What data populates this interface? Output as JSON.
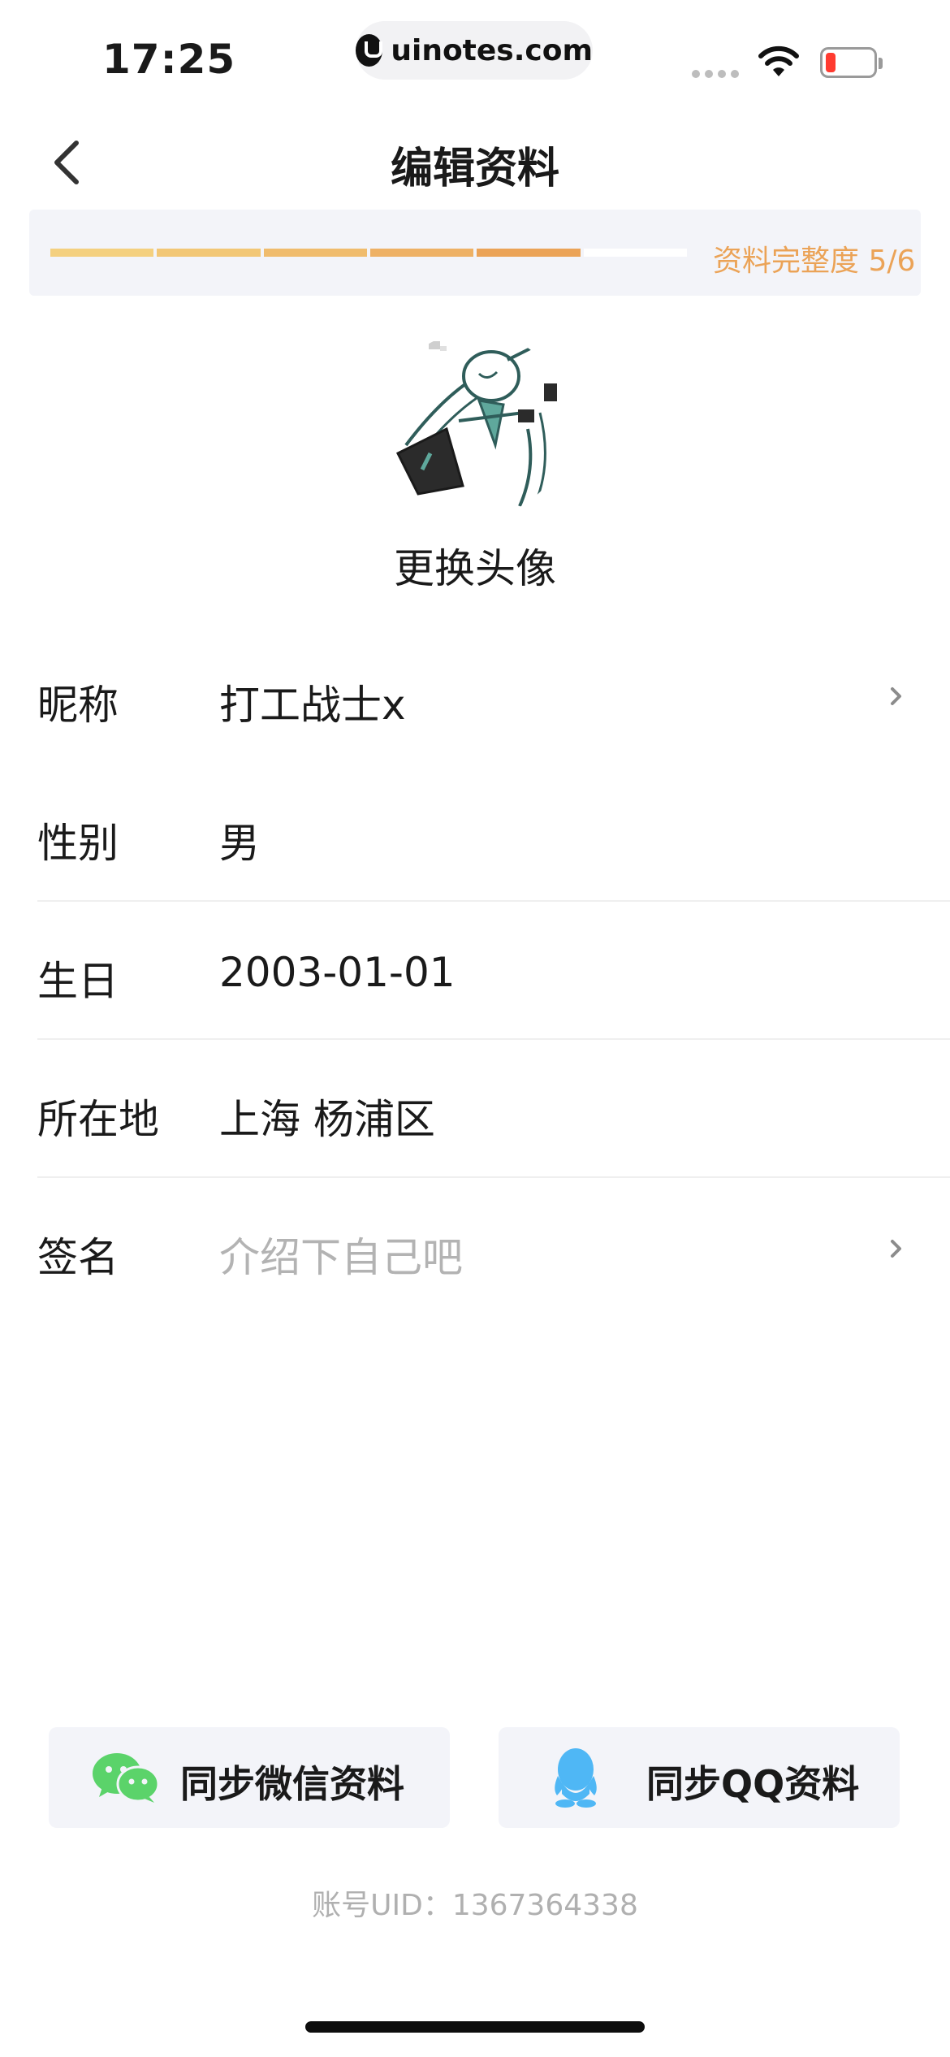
{
  "status_bar": {
    "time": "17:25",
    "url": "uinotes.com",
    "icons": [
      "signal-dots-icon",
      "wifi-icon",
      "battery-low-icon"
    ],
    "battery_color": "#ff3b30"
  },
  "nav": {
    "title": "编辑资料",
    "back_icon": "chevron-left-icon"
  },
  "profile_completion": {
    "label": "资料完整度 5/6",
    "completed_steps": 5,
    "total_steps": 6,
    "segment_colors": [
      "#f4d07f",
      "#f2c776",
      "#f0bc6d",
      "#eeb165",
      "#eba357",
      "#ffffff"
    ],
    "label_color": "#eba357"
  },
  "avatar": {
    "caption": "更换头像"
  },
  "form": {
    "rows": [
      {
        "label": "昵称",
        "value": "打工战士x",
        "chevron": true,
        "placeholder": false
      },
      {
        "label": "性别",
        "value": "男",
        "chevron": false,
        "placeholder": false
      },
      {
        "label": "生日",
        "value": "2003-01-01",
        "chevron": false,
        "placeholder": false
      },
      {
        "label": "所在地",
        "value": "上海 杨浦区",
        "chevron": false,
        "placeholder": false
      },
      {
        "label": "签名",
        "value": "介绍下自己吧",
        "chevron": true,
        "placeholder": true
      }
    ]
  },
  "sync": {
    "wechat_label": "同步微信资料",
    "wechat_icon": "wechat-icon",
    "wechat_color": "#5bd36a",
    "qq_label": "同步QQ资料",
    "qq_icon": "qq-icon",
    "qq_color": "#4fb7f5"
  },
  "account": {
    "uid_text": "账号UID：1367364338"
  }
}
